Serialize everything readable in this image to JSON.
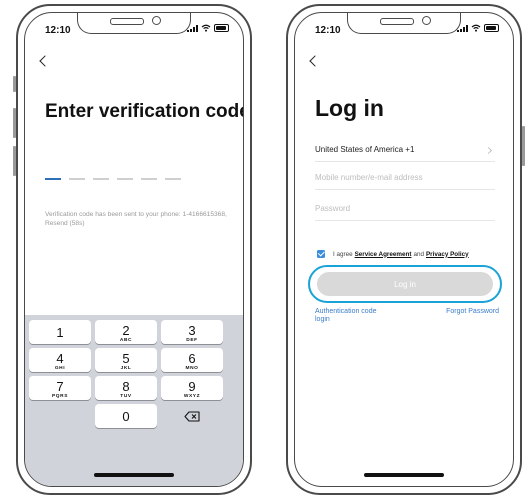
{
  "status_bar": {
    "time": "12:10"
  },
  "verify_screen": {
    "title": "Enter verification code",
    "sent_message": "Verification code has been sent to your phone: 1-4166615368, Resend (58s)",
    "keypad": [
      {
        "digit": "1",
        "letters": ""
      },
      {
        "digit": "2",
        "letters": "ABC"
      },
      {
        "digit": "3",
        "letters": "DEF"
      },
      {
        "digit": "4",
        "letters": "GHI"
      },
      {
        "digit": "5",
        "letters": "JKL"
      },
      {
        "digit": "6",
        "letters": "MNO"
      },
      {
        "digit": "7",
        "letters": "PQRS"
      },
      {
        "digit": "8",
        "letters": "TUV"
      },
      {
        "digit": "9",
        "letters": "WXYZ"
      },
      {
        "digit": "0",
        "letters": ""
      }
    ]
  },
  "login_screen": {
    "title": "Log in",
    "country": "United States of America +1",
    "mobile_placeholder": "Mobile number/e-mail address",
    "password_placeholder": "Password",
    "agree_prefix": "I agree",
    "service_agreement": "Service Agreement",
    "agree_and": "and",
    "privacy_policy": "Privacy Policy",
    "login_button": "Log in",
    "auth_code_login": "Authentication code login",
    "forgot_password": "Forgot Password",
    "accent_color": "#3a8edc",
    "highlight_color": "#1aa3d6"
  }
}
